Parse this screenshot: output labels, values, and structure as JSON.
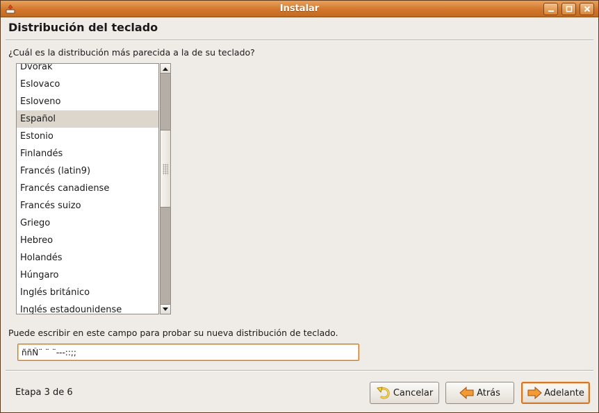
{
  "window": {
    "title": "Instalar"
  },
  "header": {
    "title": "Distribución del teclado"
  },
  "question": "¿Cuál es la distribución más parecida a la de su teclado?",
  "layouts": {
    "items": [
      {
        "label": "Dvorak"
      },
      {
        "label": "Eslovaco"
      },
      {
        "label": "Esloveno"
      },
      {
        "label": "Español",
        "selected": true
      },
      {
        "label": "Estonio"
      },
      {
        "label": "Finlandés"
      },
      {
        "label": "Francés (latin9)"
      },
      {
        "label": "Francés canadiense"
      },
      {
        "label": "Francés suizo"
      },
      {
        "label": "Griego"
      },
      {
        "label": "Hebreo"
      },
      {
        "label": "Holandés"
      },
      {
        "label": "Húngaro"
      },
      {
        "label": "Inglés británico"
      },
      {
        "label": "Inglés estadounidense"
      }
    ],
    "selected": "Español"
  },
  "test": {
    "label": "Puede escribir en este campo para probar su nueva distribución de teclado.",
    "value": "ññÑ¨ ¨ ¨---::;;"
  },
  "footer": {
    "step": "Etapa 3 de 6",
    "cancel_label": "Cancelar",
    "back_label": "Atrás",
    "forward_label": "Adelante"
  },
  "colors": {
    "titlebar": "#d2762c",
    "focus_accent": "#d0782e",
    "selection": "#ddd6cd",
    "background": "#efebe7"
  },
  "icons": {
    "app": "installer-icon",
    "minimize": "minimize-icon",
    "maximize": "maximize-icon",
    "close": "close-icon",
    "cancel": "undo-icon",
    "back": "arrow-left-icon",
    "forward": "arrow-right-icon"
  }
}
